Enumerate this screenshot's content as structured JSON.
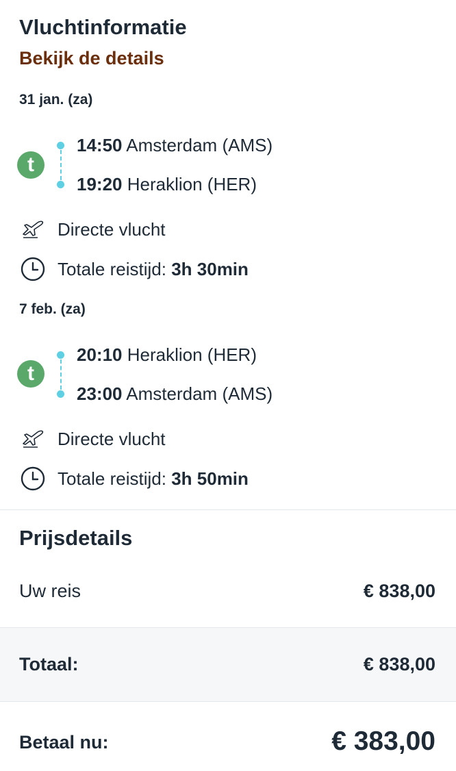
{
  "flight_info": {
    "title": "Vluchtinformatie",
    "details_link": "Bekijk de details",
    "legs": [
      {
        "date": "31 jan. (za)",
        "airline_logo_letter": "t",
        "departure": {
          "time": "14:50",
          "place": "Amsterdam (AMS)"
        },
        "arrival": {
          "time": "19:20",
          "place": "Heraklion (HER)"
        },
        "flight_type": "Directe vlucht",
        "duration_label": "Totale reistijd:",
        "duration_value": "3h 30min"
      },
      {
        "date": "7 feb. (za)",
        "airline_logo_letter": "t",
        "departure": {
          "time": "20:10",
          "place": "Heraklion (HER)"
        },
        "arrival": {
          "time": "23:00",
          "place": "Amsterdam (AMS)"
        },
        "flight_type": "Directe vlucht",
        "duration_label": "Totale reistijd:",
        "duration_value": "3h 50min"
      }
    ]
  },
  "price_details": {
    "title": "Prijsdetails",
    "trip_label": "Uw reis",
    "trip_value": "€ 838,00",
    "total_label": "Totaal:",
    "total_value": "€ 838,00",
    "pay_now_label": "Betaal nu:",
    "pay_now_value": "€ 383,00"
  },
  "colors": {
    "link": "#6b2f0d",
    "route_dots": "#5fd0e3",
    "airline_logo": "#5aa96a",
    "text": "#1f2a37"
  },
  "icons": {
    "airline": "transavia-logo-icon",
    "flight": "plane-icon",
    "duration": "clock-icon"
  }
}
